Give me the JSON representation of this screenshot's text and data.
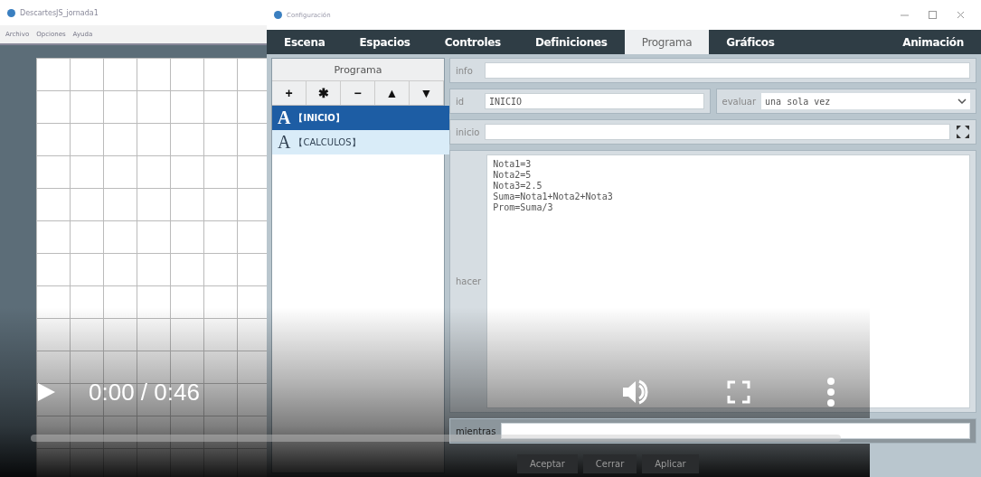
{
  "main_window": {
    "title": "DescartesJS_jornada1",
    "menu": [
      "Archivo",
      "Opciones",
      "Ayuda"
    ]
  },
  "config_window": {
    "title": "Configuración",
    "tabs": [
      {
        "label": "Escena",
        "selected": false
      },
      {
        "label": "Espacios",
        "selected": false
      },
      {
        "label": "Controles",
        "selected": false
      },
      {
        "label": "Definiciones",
        "selected": false
      },
      {
        "label": "Programa",
        "selected": true
      },
      {
        "label": "Gráficos",
        "selected": false
      },
      {
        "label": "Animación",
        "selected": false
      }
    ],
    "program_panel": {
      "title": "Programa",
      "tools": [
        "+",
        "✱",
        "−",
        "▲",
        "▼"
      ],
      "items": [
        {
          "glyph": "A",
          "label": "【INICIO】",
          "selected": true
        },
        {
          "glyph": "A",
          "label": "【CALCULOS】",
          "selected": false
        }
      ]
    },
    "form": {
      "info": {
        "label": "info"
      },
      "id": {
        "label": "id",
        "value": "INICIO"
      },
      "evaluar": {
        "label": "evaluar",
        "value": "una sola vez"
      },
      "inicio": {
        "label": "inicio"
      },
      "hacer": {
        "label": "hacer",
        "lines": [
          "Nota1=3",
          "Nota2=5",
          "Nota3=2.5",
          "Suma=Nota1+Nota2+Nota3",
          "Prom=Suma/3"
        ]
      },
      "mientras": {
        "label": "mientras"
      }
    },
    "buttons": [
      "Aceptar",
      "Cerrar",
      "Aplicar"
    ]
  },
  "player": {
    "time": "0:00 / 0:46",
    "progress": {
      "level": 0
    }
  }
}
